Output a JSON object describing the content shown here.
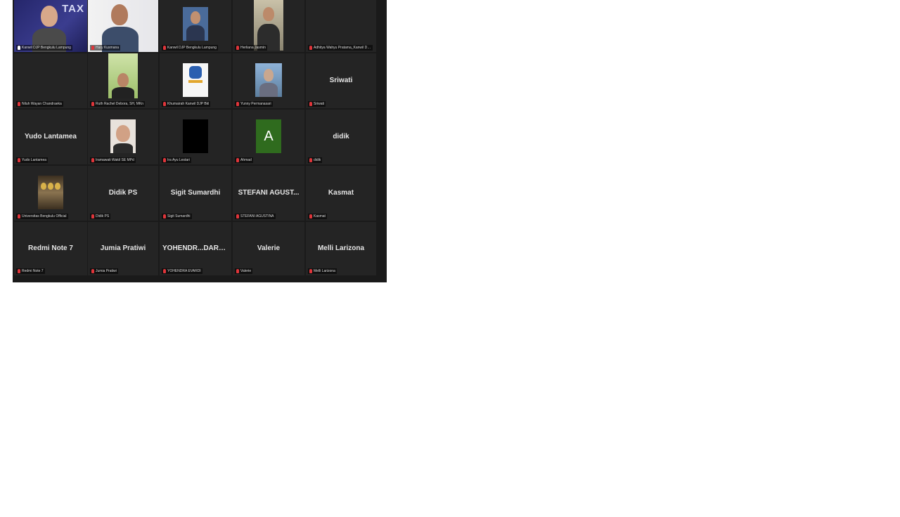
{
  "window": {
    "corner_button_glyph": "…"
  },
  "tiles": [
    {
      "name": "Kanwil DJP Bengkulu Lampung",
      "mic": "on",
      "center": "",
      "overlay": "TAX"
    },
    {
      "name": "Hary Kusmana",
      "mic": "off",
      "center": ""
    },
    {
      "name": "Kanwil DJP Bengkulu Lampung",
      "mic": "off",
      "center": ""
    },
    {
      "name": "Herliana Jasmin",
      "mic": "off",
      "center": ""
    },
    {
      "name": "Adhitya Wahyu Pratama_Kanwil DJP Bengkulu",
      "mic": "off",
      "center": ""
    },
    {
      "name": "Niluh Wayan Chandraeka",
      "mic": "off",
      "center": ""
    },
    {
      "name": "Ruth Rachel Debora, SH, MKn",
      "mic": "off",
      "center": ""
    },
    {
      "name": "Khumairah Kanwil DJP Bkl",
      "mic": "off",
      "center": ""
    },
    {
      "name": "Yunny Permanasari",
      "mic": "off",
      "center": ""
    },
    {
      "name": "Sriwati",
      "mic": "off",
      "center": "Sriwati"
    },
    {
      "name": "Yudo Lantamea",
      "mic": "off",
      "center": "Yudo Lantamea"
    },
    {
      "name": "Iramawati Wakil SE MPd",
      "mic": "off",
      "center": ""
    },
    {
      "name": "Ira Ayu Lestari",
      "mic": "off",
      "center": ""
    },
    {
      "name": "Ahmad",
      "mic": "off",
      "center": "",
      "avatar_letter": "A"
    },
    {
      "name": "didik",
      "mic": "off",
      "center": "didik"
    },
    {
      "name": "Universitas Bengkulu Official",
      "mic": "off",
      "center": ""
    },
    {
      "name": "Didik PS",
      "mic": "off",
      "center": "Didik PS"
    },
    {
      "name": "Sigit Sumardhi",
      "mic": "off",
      "center": "Sigit Sumardhi"
    },
    {
      "name": "STEFANI AGUSTINA",
      "mic": "off",
      "center": "STEFANI AGUST..."
    },
    {
      "name": "Kasmat",
      "mic": "off",
      "center": "Kasmat"
    },
    {
      "name": "Redmi Note 7",
      "mic": "off",
      "center": "Redmi Note 7"
    },
    {
      "name": "Jumia Pratiwi",
      "mic": "off",
      "center": "Jumia Pratiwi"
    },
    {
      "name": "YOHENDRA EVARDI",
      "mic": "off",
      "center": "YOHENDR...DARTO..."
    },
    {
      "name": "Valerie",
      "mic": "off",
      "center": "Valerie"
    },
    {
      "name": "Melli Larizona",
      "mic": "off",
      "center": "Melli Larizona"
    }
  ],
  "colors": {
    "speaking_border": "#d8e36a",
    "muted_mic": "#e0353a",
    "tile_bg": "#242424"
  }
}
